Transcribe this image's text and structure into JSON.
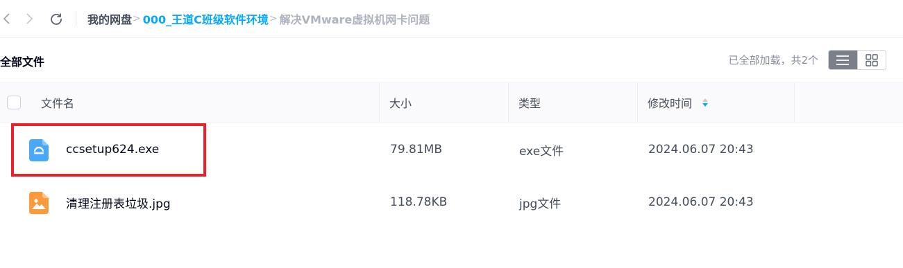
{
  "breadcrumb": {
    "root": "我的网盘",
    "folder": "000_王道C班级软件环境",
    "current": "解决VMware虚拟机网卡问题",
    "separator": ">"
  },
  "header": {
    "title": "全部文件",
    "loaded_text": "已全部加载，共2个"
  },
  "table": {
    "columns": {
      "name": "文件名",
      "size": "大小",
      "type": "类型",
      "time": "修改时间"
    },
    "rows": [
      {
        "name": "ccsetup624.exe",
        "size": "79.81MB",
        "type": "exe文件",
        "time": "2024.06.07 20:43",
        "icon": "exe-file-icon"
      },
      {
        "name": "清理注册表垃圾.jpg",
        "size": "118.78KB",
        "type": "jpg文件",
        "time": "2024.06.07 20:43",
        "icon": "image-file-icon"
      }
    ]
  },
  "colors": {
    "accent": "#06a7ff",
    "highlight": "#ec2029",
    "exe_icon": "#4aa8f6",
    "image_icon": "#fb9a3c"
  }
}
